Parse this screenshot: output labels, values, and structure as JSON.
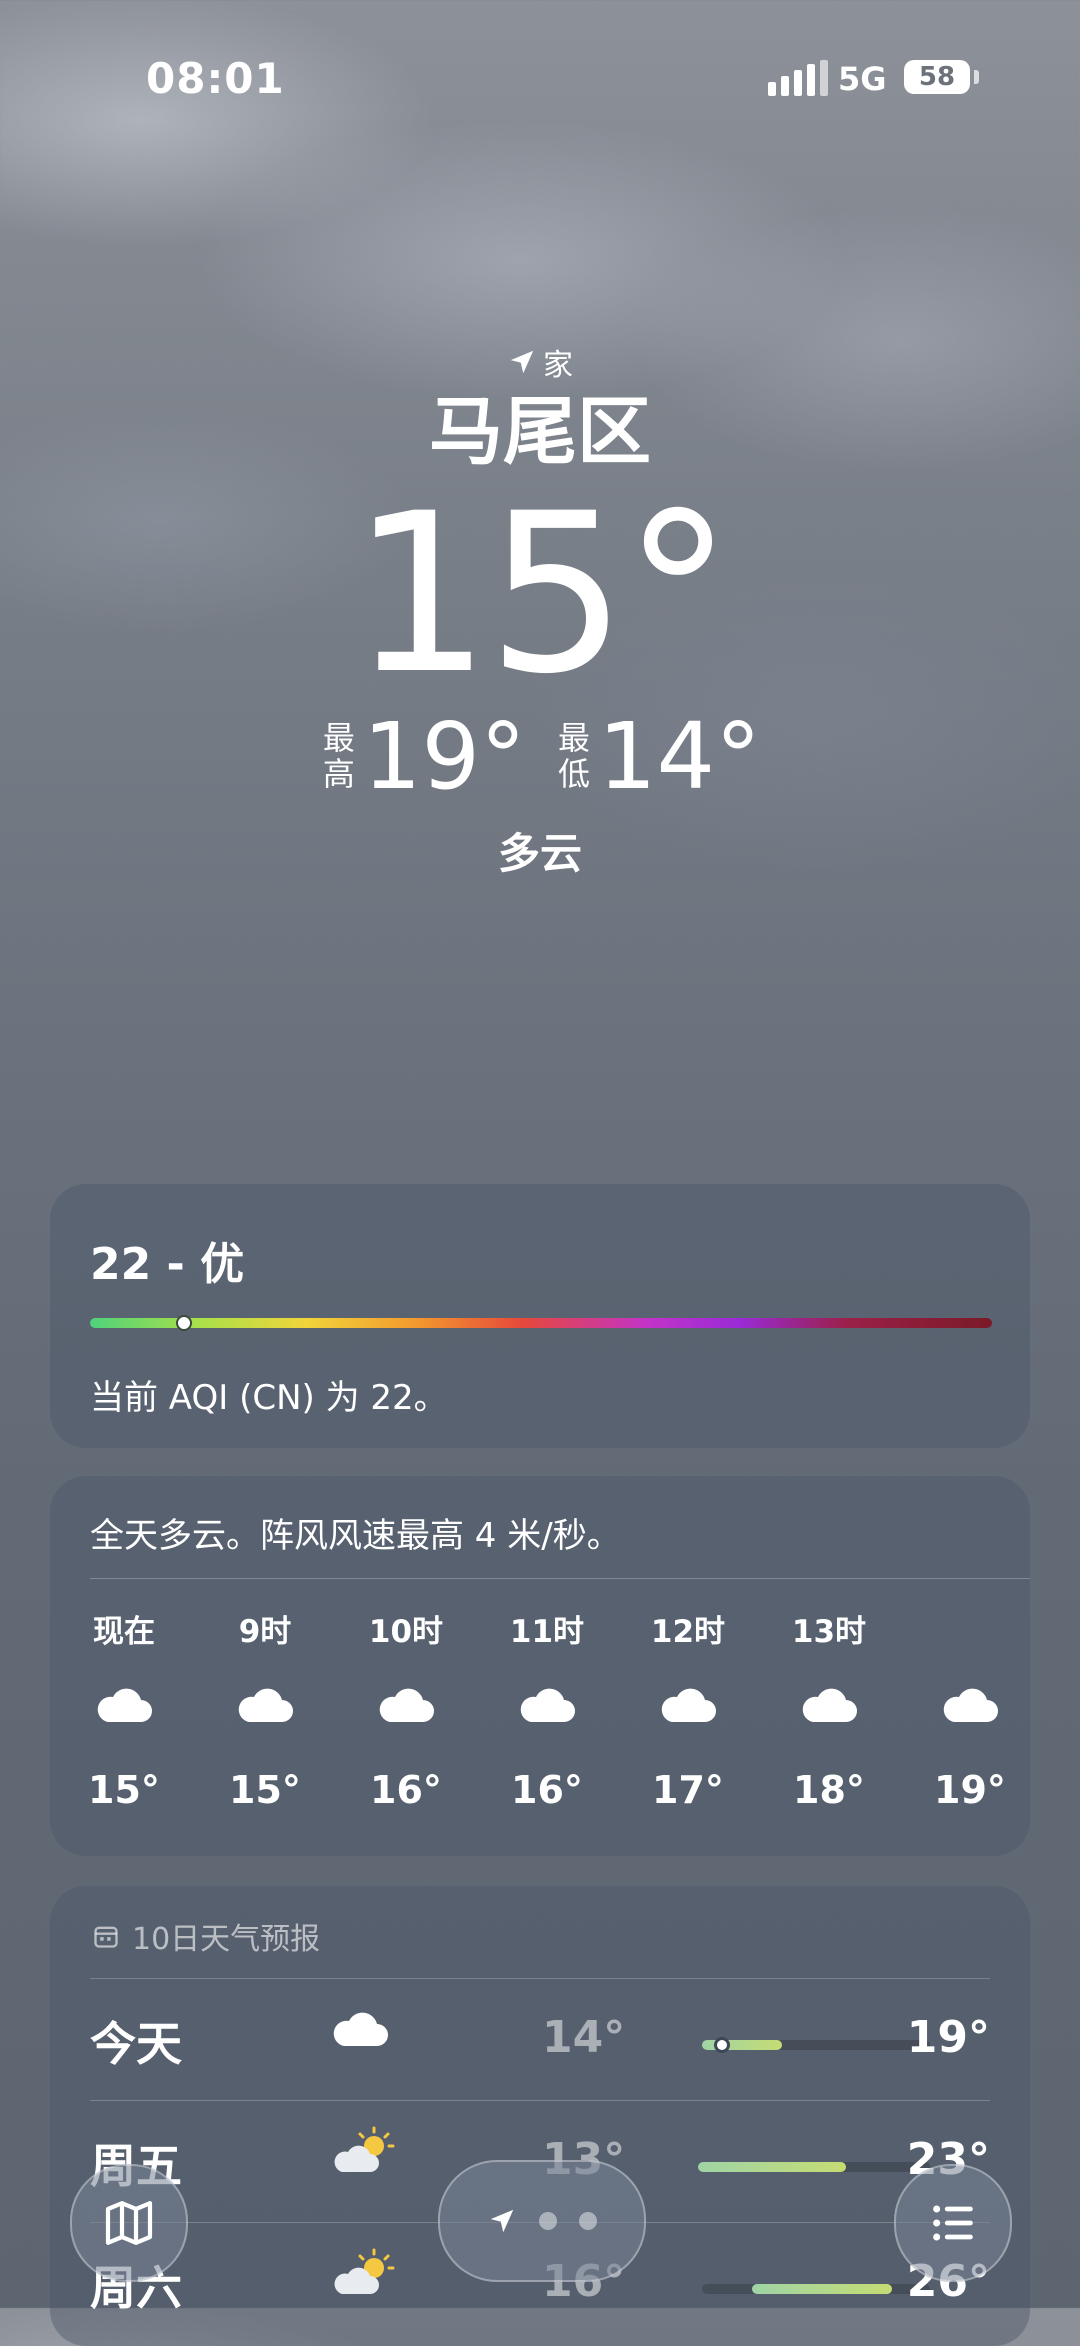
{
  "status_bar": {
    "time": "08:01",
    "network": "5G",
    "battery": "58"
  },
  "location": {
    "tag": "家",
    "city": "马尾区"
  },
  "current": {
    "temperature": "15°",
    "high_label": "最高",
    "high": "19°",
    "low_label": "最低",
    "low": "14°",
    "condition": "多云"
  },
  "aqi": {
    "title": "22 - 优",
    "value": 22,
    "description": "当前 AQI (CN) 为 22。"
  },
  "hourly": {
    "summary": "全天多云。阵风风速最高 4 米/秒。",
    "items": [
      {
        "time": "现在",
        "icon": "cloud-icon",
        "temp": "15°"
      },
      {
        "time": "9时",
        "icon": "cloud-icon",
        "temp": "15°"
      },
      {
        "time": "10时",
        "icon": "cloud-icon",
        "temp": "16°"
      },
      {
        "time": "11时",
        "icon": "cloud-icon",
        "temp": "16°"
      },
      {
        "time": "12时",
        "icon": "cloud-icon",
        "temp": "17°"
      },
      {
        "time": "13时",
        "icon": "cloud-icon",
        "temp": "18°"
      },
      {
        "time": "",
        "icon": "cloud-icon",
        "temp": "19°"
      }
    ]
  },
  "ten_day": {
    "title": "10日天气预报",
    "days": [
      {
        "day": "今天",
        "icon": "cloud-icon",
        "low": "14°",
        "high": "19°"
      },
      {
        "day": "周五",
        "icon": "partly-sunny-icon",
        "low": "13°",
        "high": "23°"
      },
      {
        "day": "周六",
        "icon": "partly-sunny-icon",
        "low": "16°",
        "high": "26°"
      }
    ]
  },
  "colors": {
    "accent_fill": "#c6dc73",
    "card_bg": "rgba(75,85,102,0.42)"
  }
}
